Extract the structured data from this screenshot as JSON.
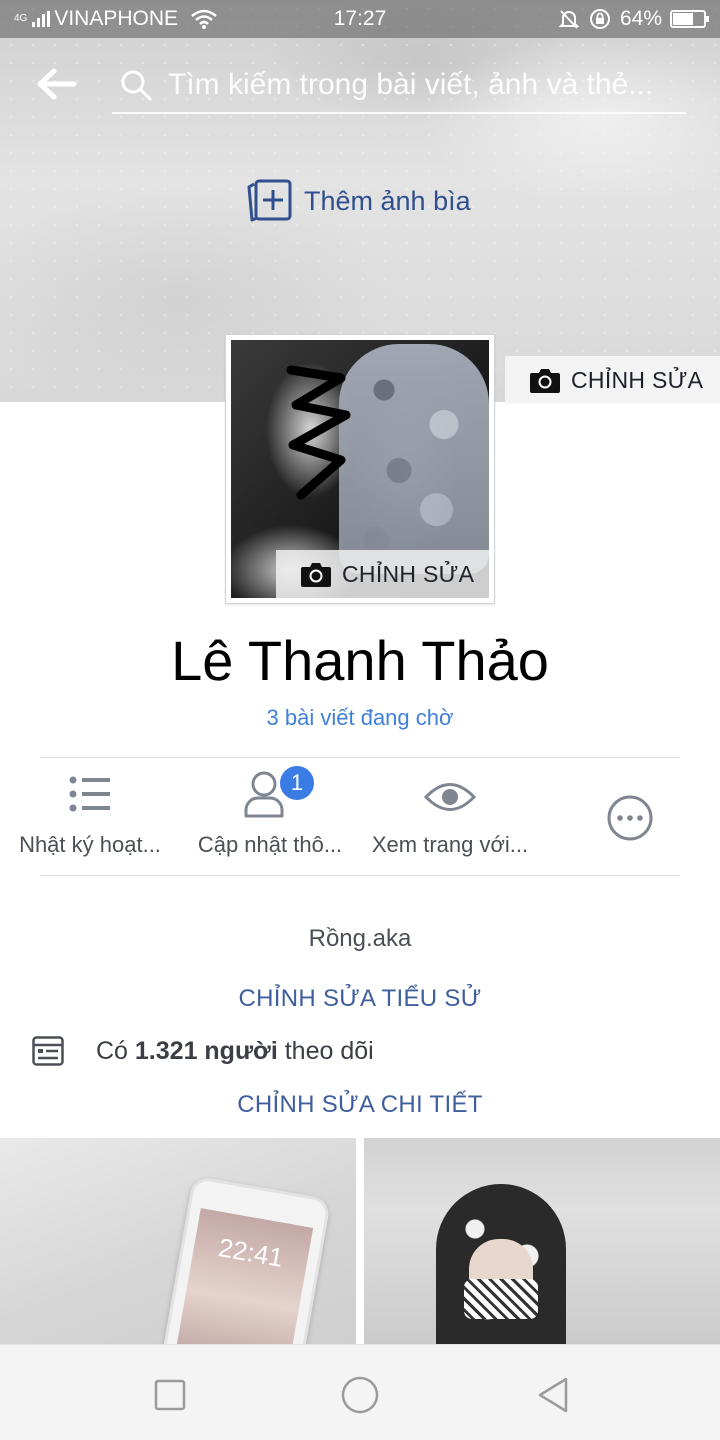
{
  "status_bar": {
    "network_tag": "4G",
    "carrier": "VINAPHONE",
    "time": "17:27",
    "battery_percent": "64%",
    "battery_level": 0.64
  },
  "search": {
    "placeholder": "Tìm kiếm trong bài viết, ảnh và thẻ..."
  },
  "cover": {
    "add_cover_label": "Thêm ảnh bìa",
    "edit_label": "CHỈNH SỬA"
  },
  "profile": {
    "photo_edit_label": "CHỈNH SỬA",
    "name": "Lê Thanh Thảo",
    "pending_posts": "3 bài viết đang chờ"
  },
  "actions": [
    {
      "label": "Nhật ký hoạt...",
      "icon": "list-icon"
    },
    {
      "label": "Cập nhật thô...",
      "icon": "person-icon",
      "badge": "1"
    },
    {
      "label": "Xem trang với...",
      "icon": "eye-icon"
    },
    {
      "label": "",
      "icon": "more-icon"
    }
  ],
  "intro": {
    "bio": "Rồng.aka",
    "edit_bio": "CHỈNH SỬA TIỂU SỬ",
    "followers_prefix": "Có ",
    "followers_count": "1.321 người",
    "followers_suffix": " theo dõi",
    "edit_details": "CHỈNH SỬA CHI TIẾT"
  },
  "photos": {
    "phone_time": "22:41"
  },
  "colors": {
    "accent_link": "#4080d9",
    "action_blue": "#3f5e9e",
    "badge": "#3b7be4",
    "cover_icon": "#2f4f8f"
  }
}
